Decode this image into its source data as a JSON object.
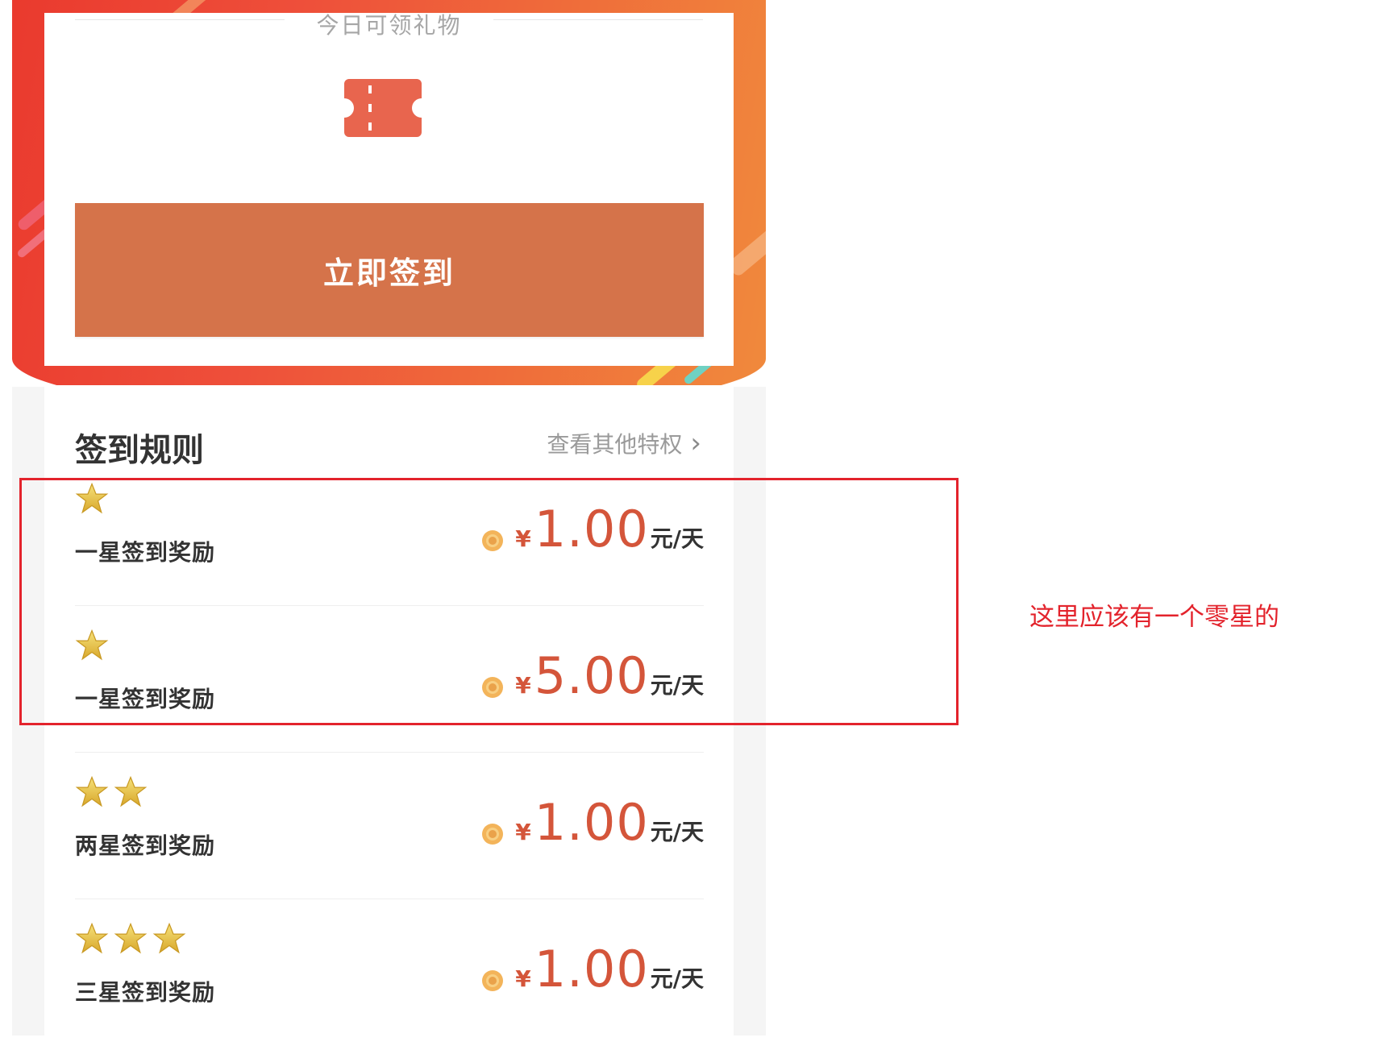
{
  "gift": {
    "title": "今日可领礼物",
    "icon": "ticket-icon",
    "sign_button": "立即签到"
  },
  "rules": {
    "title": "签到规则",
    "other_link": "查看其他特权"
  },
  "rewards": [
    {
      "label": "一星签到奖励",
      "stars": 1,
      "currency": "¥",
      "amount": "1.00",
      "unit": "元/天"
    },
    {
      "label": "一星签到奖励",
      "stars": 1,
      "currency": "¥",
      "amount": "5.00",
      "unit": "元/天"
    },
    {
      "label": "两星签到奖励",
      "stars": 2,
      "currency": "¥",
      "amount": "1.00",
      "unit": "元/天"
    },
    {
      "label": "三星签到奖励",
      "stars": 3,
      "currency": "¥",
      "amount": "1.00",
      "unit": "元/天"
    }
  ],
  "annotation": {
    "text": "这里应该有一个零星的",
    "color": "#e3232c"
  },
  "colors": {
    "button": "#d5734a",
    "price": "#d4553a",
    "header_red": "#ea3a2e",
    "header_orange": "#f08a3c"
  }
}
